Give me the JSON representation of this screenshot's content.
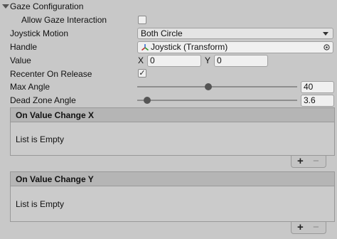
{
  "section": {
    "title": "Gaze Configuration"
  },
  "fields": {
    "allow_gaze": {
      "label": "Allow Gaze Interaction",
      "checked": false
    },
    "joystick_motion": {
      "label": "Joystick Motion",
      "value": "Both Circle"
    },
    "handle": {
      "label": "Handle",
      "value": "Joystick (Transform)"
    },
    "value": {
      "label": "Value",
      "x_label": "X",
      "x": "0",
      "y_label": "Y",
      "y": "0"
    },
    "recenter": {
      "label": "Recenter On Release",
      "checked": true,
      "check_glyph": "✓"
    },
    "max_angle": {
      "label": "Max Angle",
      "value": "40",
      "fraction": 0.44
    },
    "dead_zone": {
      "label": "Dead Zone Angle",
      "value": "3.6",
      "fraction": 0.04
    }
  },
  "events": {
    "x": {
      "title": "On Value Change X",
      "empty": "List is Empty",
      "add": "+",
      "remove": "−"
    },
    "y": {
      "title": "On Value Change Y",
      "empty": "List is Empty",
      "add": "+",
      "remove": "−"
    }
  },
  "icons": {
    "foldout": "triangle-down-icon",
    "transform": "transform-icon",
    "picker": "object-picker-icon"
  }
}
